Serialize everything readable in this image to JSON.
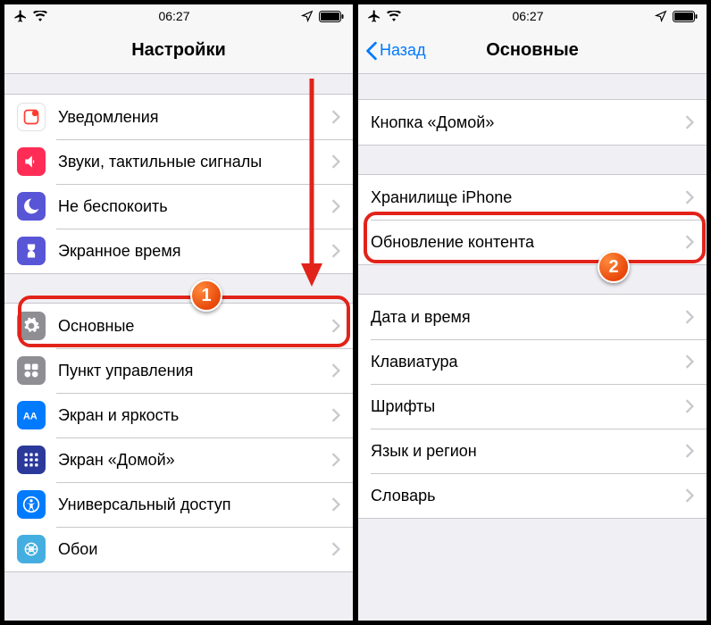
{
  "statusbar": {
    "time": "06:27"
  },
  "left": {
    "title": "Настройки",
    "group1": [
      {
        "icon": "notifications",
        "label": "Уведомления"
      },
      {
        "icon": "sounds",
        "label": "Звуки, тактильные сигналы"
      },
      {
        "icon": "dnd",
        "label": "Не беспокоить"
      },
      {
        "icon": "screentime",
        "label": "Экранное время"
      }
    ],
    "group2": [
      {
        "icon": "general",
        "label": "Основные"
      },
      {
        "icon": "control",
        "label": "Пункт управления"
      },
      {
        "icon": "display",
        "label": "Экран и яркость"
      },
      {
        "icon": "home",
        "label": "Экран «Домой»"
      },
      {
        "icon": "accessibility",
        "label": "Универсальный доступ"
      },
      {
        "icon": "wallpaper",
        "label": "Обои"
      }
    ]
  },
  "right": {
    "back": "Назад",
    "title": "Основные",
    "group1": [
      {
        "label": "Кнопка «Домой»"
      }
    ],
    "group2": [
      {
        "label": "Хранилище iPhone"
      },
      {
        "label": "Обновление контента"
      }
    ],
    "group3": [
      {
        "label": "Дата и время"
      },
      {
        "label": "Клавиатура"
      },
      {
        "label": "Шрифты"
      },
      {
        "label": "Язык и регион"
      },
      {
        "label": "Словарь"
      }
    ]
  },
  "callouts": {
    "badge1": "1",
    "badge2": "2"
  }
}
